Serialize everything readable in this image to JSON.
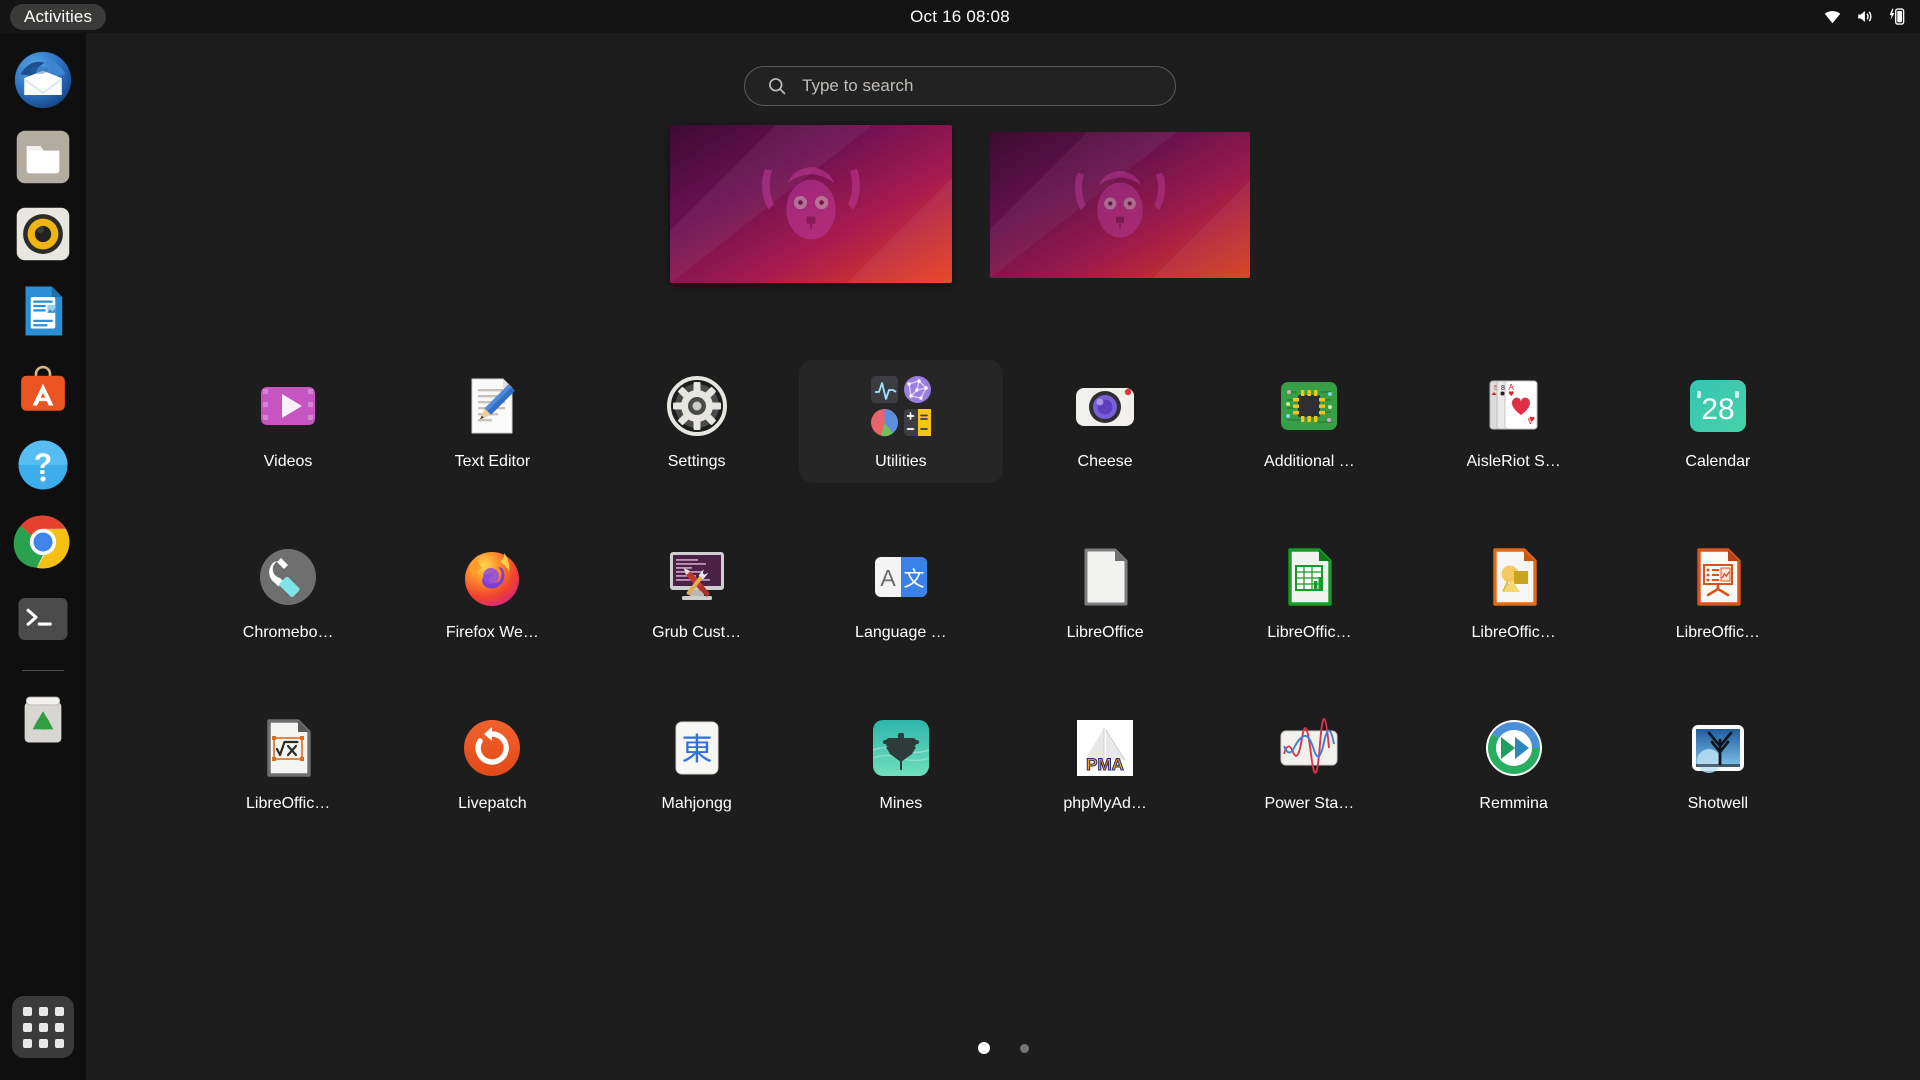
{
  "topbar": {
    "activities_label": "Activities",
    "clock": "Oct 16  08:08",
    "status_icons": [
      {
        "name": "wifi-icon"
      },
      {
        "name": "volume-icon"
      },
      {
        "name": "battery-charging-icon"
      }
    ]
  },
  "dock": {
    "items": [
      {
        "name": "thunderbird",
        "label": "Thunderbird Mail"
      },
      {
        "name": "files",
        "label": "Files"
      },
      {
        "name": "rhythmbox",
        "label": "Rhythmbox"
      },
      {
        "name": "libreoffice-writer",
        "label": "LibreOffice Writer"
      },
      {
        "name": "ubuntu-software",
        "label": "Ubuntu Software"
      },
      {
        "name": "help",
        "label": "Help"
      },
      {
        "name": "google-chrome",
        "label": "Google Chrome"
      },
      {
        "name": "terminal",
        "label": "Terminal"
      },
      {
        "name": "trash",
        "label": "Trash"
      }
    ],
    "show_apps_label": "Show Applications"
  },
  "search": {
    "placeholder": "Type to search",
    "value": "",
    "icon": "search-icon"
  },
  "workspaces": {
    "items": [
      {
        "name": "workspace-1",
        "active": true
      },
      {
        "name": "workspace-2",
        "active": false
      }
    ],
    "wallpaper": "ubuntu-jammy-lemur"
  },
  "app_grid": {
    "apps": [
      {
        "label": "Videos",
        "icon": "videos-icon",
        "folder": false
      },
      {
        "label": "Text Editor",
        "icon": "text-editor-icon",
        "folder": false
      },
      {
        "label": "Settings",
        "icon": "settings-icon",
        "folder": false
      },
      {
        "label": "Utilities",
        "icon": "utilities-folder-icon",
        "folder": true
      },
      {
        "label": "Cheese",
        "icon": "cheese-icon",
        "folder": false
      },
      {
        "label": "Additional …",
        "icon": "additional-drivers-icon",
        "folder": false
      },
      {
        "label": "AisleRiot S…",
        "icon": "aisleriot-solitaire-icon",
        "folder": false
      },
      {
        "label": "Calendar",
        "icon": "calendar-icon",
        "folder": false
      },
      {
        "label": "Chromebo…",
        "icon": "chromebook-recovery-icon",
        "folder": false
      },
      {
        "label": "Firefox We…",
        "icon": "firefox-icon",
        "folder": false
      },
      {
        "label": "Grub Cust…",
        "icon": "grub-customizer-icon",
        "folder": false
      },
      {
        "label": "Language …",
        "icon": "language-support-icon",
        "folder": false
      },
      {
        "label": "LibreOffice",
        "icon": "libreoffice-start-center-icon",
        "folder": false
      },
      {
        "label": "LibreOffic…",
        "icon": "libreoffice-calc-icon",
        "folder": false
      },
      {
        "label": "LibreOffic…",
        "icon": "libreoffice-draw-icon",
        "folder": false
      },
      {
        "label": "LibreOffic…",
        "icon": "libreoffice-impress-icon",
        "folder": false
      },
      {
        "label": "LibreOffic…",
        "icon": "libreoffice-math-icon",
        "folder": false
      },
      {
        "label": "Livepatch",
        "icon": "livepatch-icon",
        "folder": false
      },
      {
        "label": "Mahjongg",
        "icon": "mahjongg-icon",
        "folder": false
      },
      {
        "label": "Mines",
        "icon": "mines-icon",
        "folder": false
      },
      {
        "label": "phpMyAd…",
        "icon": "phpmyadmin-icon",
        "folder": false
      },
      {
        "label": "Power Sta…",
        "icon": "power-statistics-icon",
        "folder": false
      },
      {
        "label": "Remmina",
        "icon": "remmina-icon",
        "folder": false
      },
      {
        "label": "Shotwell",
        "icon": "shotwell-icon",
        "folder": false
      }
    ],
    "calendar_day": "28",
    "mahjongg_glyph": "東",
    "phpmyadmin_text": "PMA",
    "utilities_children": [
      "system-monitor-icon",
      "disk-usage-analyzer-icon",
      "disks-icon",
      "calculator-icon"
    ]
  },
  "pagination": {
    "pages": [
      {
        "name": "page-1",
        "active": true
      },
      {
        "name": "page-2",
        "active": false
      }
    ],
    "current": 1,
    "total": 2
  },
  "colors": {
    "top_bar": "#141414",
    "desktop_bg": "#1d1d1d",
    "dock_bg": "#0f0f0f",
    "accent_orange": "#E95420",
    "text": "#ffffff",
    "placeholder_text": "#c2bdb8",
    "folder_bg": "#262626"
  }
}
